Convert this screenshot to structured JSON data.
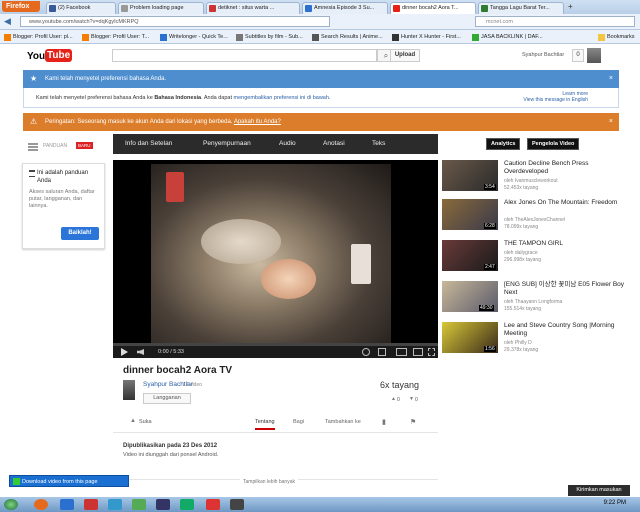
{
  "browser": {
    "menu_button": "Firefox",
    "tabs": [
      {
        "label": "(2) Facebook",
        "color": "#3b5998"
      },
      {
        "label": "Problem loading page",
        "color": "#999999"
      },
      {
        "label": "detiknet : situs warta ...",
        "color": "#c33333"
      },
      {
        "label": "Amnesia Episode 3 Su...",
        "color": "#2b6fcf"
      },
      {
        "label": "dinner bocah2 Aora T...",
        "color": "#e62117"
      },
      {
        "label": "Tangga Lagu Barat Ter...",
        "color": "#2f7b2f"
      }
    ],
    "url": "www.youtube.com/watch?v=dqKgyIcMKRPQ",
    "search_engine": "mcnet.com",
    "bookmarks": [
      "Blogger: Profil User: pl...",
      "Blogger: Profil User: T...",
      "Writelonger - Quick Te...",
      "Subtitles by film - Sub...",
      "Search Results | Anime...",
      "Hunter X Hunter - First...",
      "JASA BACKLINK | DAF..."
    ],
    "bookmarks_menu": "Bookmarks"
  },
  "youtube": {
    "logo_you": "You",
    "logo_tube": "Tube",
    "upload_label": "Upload",
    "user_name": "Syahpur Bachtiar",
    "notifications": "0"
  },
  "alerts": {
    "lang_title": "Kami telah menyetel preferensi bahasa Anda.",
    "lang_body_prefix": "Kami telah menyetel preferensi bahasa Anda ke",
    "lang_body_lang": "Bahasa Indonesia",
    "lang_body_suffix": ". Anda dapat",
    "lang_body_link": "mengembalikan preferensi ini di bawah",
    "lang_learn": "Learn more",
    "lang_view_english": "View this message in English",
    "warning_text": "Peringatan: Seseorang masuk ke akun Anda dari lokasi yang berbeda.",
    "warning_link": "Apakah itu Anda?",
    "close": "×"
  },
  "guide": {
    "label": "PANDUAN",
    "badge": "BARU",
    "title": "Ini adalah panduan Anda",
    "description": "Akses saluran Anda, daftar putar, langganan, dan lainnya.",
    "button": "Baiklah!"
  },
  "video_tabs": [
    "Info dan Setelan",
    "Penyempurnaan",
    "Audio",
    "Anotasi",
    "Teks"
  ],
  "video_tab_buttons": [
    "Analytics",
    "Pengelola Video"
  ],
  "player": {
    "time": "0:00 / 5:33"
  },
  "video": {
    "title": "dinner bocah2 Aora TV",
    "channel": "Syahpur Bachtiar",
    "video_count": "17 video",
    "subscribe_label": "Langganan",
    "views": "6x tayang",
    "likes": "0",
    "dislikes": "0",
    "like_label": "Suka",
    "action_tabs": [
      "Tentang",
      "Bagi",
      "Tambahkan ke"
    ],
    "published": "Dipublikasikan pada 23 Des 2012",
    "description": "Video ini diunggah dari ponsel Android.",
    "show_more": "Tampilkan lebih banyak"
  },
  "suggestions": [
    {
      "title": "Caution Decline Bench Press Overdeveloped",
      "by": "oleh Ivanmuscleworkout",
      "views": "52.453x tayang",
      "duration": "3:54"
    },
    {
      "title": "Alex Jones On The Mountain: Freedom",
      "by": "oleh TheAlexJonesChannel",
      "views": "78.099x tayang",
      "duration": "6:28"
    },
    {
      "title": "THE TAMPON GIRL",
      "by": "oleh dailygrace",
      "views": "296.998x tayang",
      "duration": "2:47"
    },
    {
      "title": "[ENG SUB] 이상한 꽃미남 E05 Flower Boy Next",
      "by": "oleh Thaayann Longforma",
      "views": "155.514x tayang",
      "duration": "49:30"
    },
    {
      "title": "Lee and Steve Country Song |Morning Meeting",
      "by": "oleh Philly D",
      "views": "29.378x tayang",
      "duration": "1:56"
    }
  ],
  "download_bar": "Download video from this page",
  "feedback": "Kirimkan masukan",
  "clock": "9:22 PM"
}
